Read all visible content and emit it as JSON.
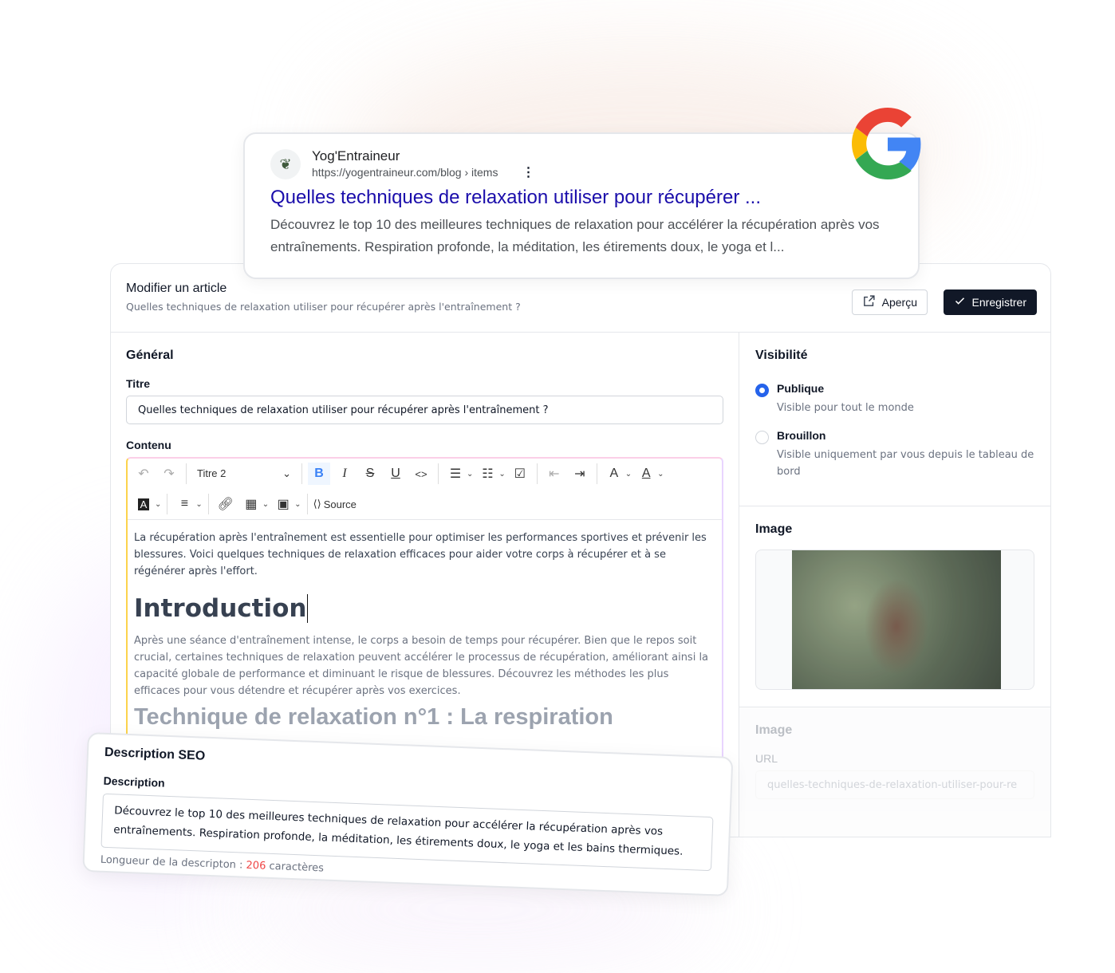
{
  "google": {
    "site_name": "Yog'Entraineur",
    "url": "https://yogentraineur.com/blog › items",
    "title": "Quelles techniques de relaxation utiliser pour récupérer ...",
    "snippet": "Découvrez le top 10 des meilleures techniques de relaxation pour accélérer la récupération après vos entraînements. Respiration profonde, la méditation, les étirements doux, le yoga et l..."
  },
  "header": {
    "title": "Modifier un article",
    "subtitle": "Quelles techniques de relaxation utiliser pour récupérer après l'entraînement ?",
    "preview_label": "Aperçu",
    "save_label": "Enregistrer"
  },
  "general": {
    "heading": "Général",
    "title_label": "Titre",
    "title_value": "Quelles techniques de relaxation utiliser pour récupérer après l'entraînement ?",
    "content_label": "Contenu"
  },
  "toolbar": {
    "heading_select": "Titre 2",
    "source_label": "Source"
  },
  "content": {
    "p1": "La récupération après l'entraînement est essentielle pour optimiser les performances sportives et prévenir les blessures. Voici quelques techniques de relaxation efficaces pour aider votre corps à récupérer et à se régénérer après l'effort.",
    "h1": "Introduction",
    "p2": "Après une séance d'entraînement intense, le corps a besoin de temps pour récupérer. Bien que le repos soit crucial, certaines techniques de relaxation peuvent accélérer le processus de récupération, améliorant ainsi la capacité globale de performance et diminuant le risque de blessures. Découvrez les méthodes les plus efficaces pour vous détendre et récupérer après vos exercices.",
    "h2": "Technique de relaxation n°1 : La respiration"
  },
  "visibility": {
    "heading": "Visibilité",
    "options": [
      {
        "label": "Publique",
        "desc": "Visible pour tout le monde",
        "selected": true
      },
      {
        "label": "Brouillon",
        "desc": "Visible uniquement par vous depuis le tableau de bord",
        "selected": false
      }
    ]
  },
  "image": {
    "heading": "Image"
  },
  "seo_image": {
    "heading": "Image",
    "url_label": "URL",
    "url_value": "quelles-techniques-de-relaxation-utiliser-pour-re"
  },
  "seo": {
    "heading": "Description SEO",
    "desc_label": "Description",
    "desc_value": "Découvrez le top 10 des meilleures techniques de relaxation pour accélérer la récupération après vos entraînements. Respiration profonde, la méditation, les étirements doux, le yoga et les bains thermiques.",
    "length_prefix": "Longueur de la descripton : ",
    "length_count": "206",
    "length_suffix": " caractères"
  },
  "colors": {
    "accent": "#2563eb",
    "link": "#1a0dab",
    "count": "#ef4444",
    "dark": "#111827"
  }
}
